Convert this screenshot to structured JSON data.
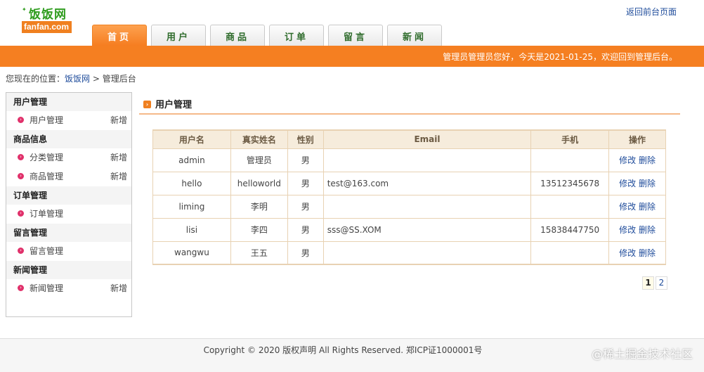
{
  "logo": {
    "cn": "饭饭网",
    "en": "fanfan.com"
  },
  "back_link": "返回前台页面",
  "nav": {
    "tabs": [
      {
        "label": "首页",
        "active": true
      },
      {
        "label": "用户",
        "active": false
      },
      {
        "label": "商品",
        "active": false
      },
      {
        "label": "订单",
        "active": false
      },
      {
        "label": "留言",
        "active": false
      },
      {
        "label": "新闻",
        "active": false
      }
    ]
  },
  "welcome": "管理员管理员您好，今天是2021-01-25，欢迎回到管理后台。",
  "breadcrumb": {
    "prefix": "您现在的位置：",
    "link": "饭饭网",
    "sep": ">",
    "current": "管理后台"
  },
  "sidebar": {
    "groups": [
      {
        "title": "用户管理",
        "items": [
          {
            "label": "用户管理",
            "add": "新增"
          }
        ]
      },
      {
        "title": "商品信息",
        "items": [
          {
            "label": "分类管理",
            "add": "新增"
          },
          {
            "label": "商品管理",
            "add": "新增"
          }
        ]
      },
      {
        "title": "订单管理",
        "items": [
          {
            "label": "订单管理",
            "add": ""
          }
        ]
      },
      {
        "title": "留言管理",
        "items": [
          {
            "label": "留言管理",
            "add": ""
          }
        ]
      },
      {
        "title": "新闻管理",
        "items": [
          {
            "label": "新闻管理",
            "add": "新增"
          }
        ]
      }
    ]
  },
  "main": {
    "title": "用户管理",
    "table": {
      "headers": [
        "用户名",
        "真实姓名",
        "性别",
        "Email",
        "手机",
        "操作"
      ],
      "rows": [
        {
          "username": "admin",
          "realname": "管理员",
          "gender": "男",
          "email": "",
          "phone": ""
        },
        {
          "username": "hello",
          "realname": "helloworld",
          "gender": "男",
          "email": "test@163.com",
          "phone": "13512345678"
        },
        {
          "username": "liming",
          "realname": "李明",
          "gender": "男",
          "email": "",
          "phone": ""
        },
        {
          "username": "lisi",
          "realname": "李四",
          "gender": "男",
          "email": "sss@SS.XOM",
          "phone": "15838447750"
        },
        {
          "username": "wangwu",
          "realname": "王五",
          "gender": "男",
          "email": "",
          "phone": ""
        }
      ],
      "edit_label": "修改",
      "delete_label": "删除"
    },
    "pager": {
      "pages": [
        "1",
        "2"
      ],
      "current": "1"
    }
  },
  "footer": {
    "copyright": "Copyright © 2020 版权声明 All Rights Reserved. 郑ICP证1000001号",
    "watermark": "@稀土掘金技术社区"
  },
  "colors": {
    "accent": "#f57f21",
    "link": "#1f4c9b",
    "bullet": "#e0306a",
    "logo_green": "#2f9c1e"
  }
}
